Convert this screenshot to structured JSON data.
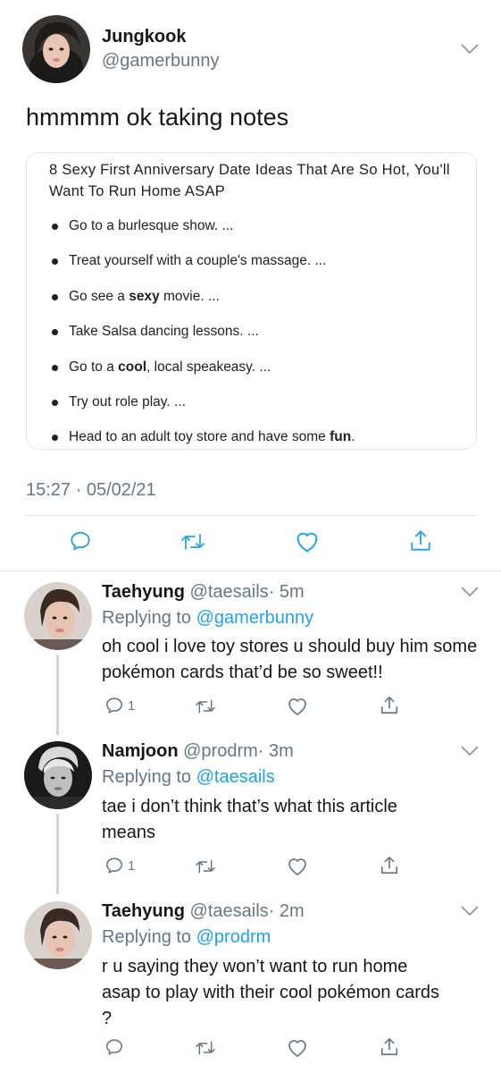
{
  "main_tweet": {
    "author_name": "Jungkook",
    "author_handle": "@gamerbunny",
    "text": "hmmmm ok taking notes",
    "card": {
      "title": "8 Sexy First Anniversary Date Ideas That Are So Hot, You'll Want To Run Home ASAP",
      "items": [
        {
          "pre": "Go to a burlesque show. ...",
          "bold": "",
          "post": ""
        },
        {
          "pre": "Treat yourself with a couple's massage. ...",
          "bold": "",
          "post": ""
        },
        {
          "pre": "Go see a ",
          "bold": "sexy",
          "post": " movie. ..."
        },
        {
          "pre": "Take Salsa dancing lessons. ...",
          "bold": "",
          "post": ""
        },
        {
          "pre": "Go to a ",
          "bold": "cool",
          "post": ", local speakeasy. ..."
        },
        {
          "pre": "Try out role play. ...",
          "bold": "",
          "post": ""
        },
        {
          "pre": "Head to an adult toy store and have some ",
          "bold": "fun",
          "post": "."
        }
      ]
    },
    "timestamp": "15:27 · 05/02/21",
    "actions": [
      "reply-icon",
      "retweet-icon",
      "like-icon",
      "share-icon"
    ]
  },
  "replies": [
    {
      "name": "Taehyung",
      "handle": "@taesails",
      "time": "· 5m",
      "replying_prefix": "Replying to ",
      "replying_to": "@gamerbunny",
      "text": "oh cool i love toy stores u should buy him some pokémon cards that’d be so sweet!!",
      "reply_count": "1"
    },
    {
      "name": "Namjoon",
      "handle": "@prodrm",
      "time": "· 3m",
      "replying_prefix": "Replying to ",
      "replying_to": "@taesails",
      "text": "tae i don’t think that’s what this article means",
      "reply_count": "1"
    },
    {
      "name": "Taehyung",
      "handle": "@taesails",
      "time": "· 2m",
      "replying_prefix": "Replying to ",
      "replying_to": "@prodrm",
      "text": "r u saying they won’t want to run home asap to play with their cool pokémon cards ?",
      "reply_count": ""
    }
  ],
  "colors": {
    "link": "#1da1f2",
    "secondary_text": "#657786",
    "divider": "#e1e8ed",
    "thread_line": "#ccd6dd"
  }
}
